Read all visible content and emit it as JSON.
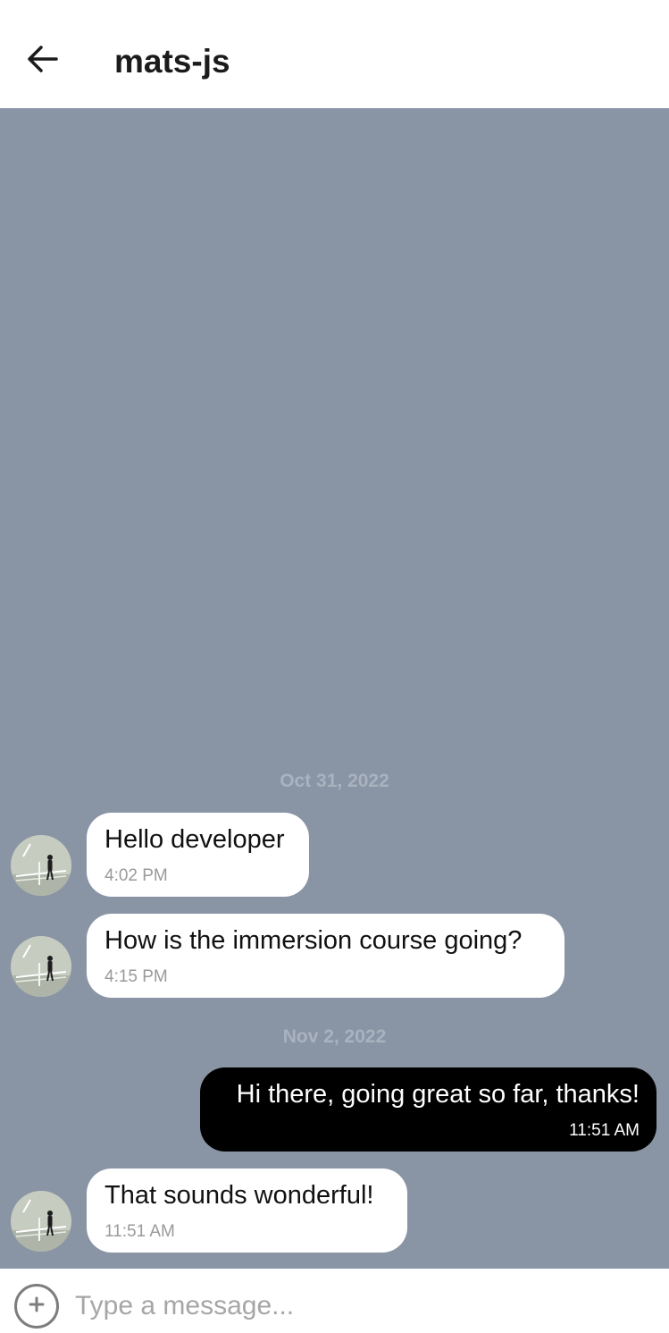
{
  "header": {
    "back_icon": "arrow-left-icon",
    "title": "mats-js"
  },
  "chat": {
    "background_color": "#8995a5",
    "outgoing_bubble_color": "#000000",
    "incoming_bubble_color": "#ffffff",
    "dates": [
      "Oct 31, 2022",
      "Nov 2, 2022"
    ],
    "messages": [
      {
        "direction": "incoming",
        "text": "Hello developer",
        "time": "4:02 PM"
      },
      {
        "direction": "incoming",
        "text": "How is the immersion course going?",
        "time": "4:15 PM"
      },
      {
        "direction": "outgoing",
        "text": "Hi there, going great so far, thanks!",
        "time": "11:51 AM"
      },
      {
        "direction": "incoming",
        "text": "That sounds wonderful!",
        "time": "11:51 AM"
      }
    ]
  },
  "composer": {
    "add_icon": "plus-circle-icon",
    "placeholder": "Type a message..."
  }
}
